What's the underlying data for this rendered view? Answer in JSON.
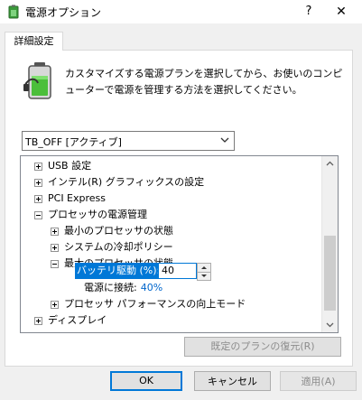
{
  "window": {
    "title": "電源オプション",
    "help": "?",
    "close": "✕"
  },
  "tab": {
    "label": "詳細設定"
  },
  "description": "カスタマイズする電源プランを選択してから、お使いのコンピューターで電源を管理する方法を選択してください。",
  "plan_select": {
    "value": "TB_OFF [アクティブ]"
  },
  "tree": {
    "items": [
      {
        "label": "USB 設定",
        "expander": "plus"
      },
      {
        "label": "インテル(R) グラフィックスの設定",
        "expander": "plus"
      },
      {
        "label": "PCI Express",
        "expander": "plus"
      },
      {
        "label": "プロセッサの電源管理",
        "expander": "minus"
      },
      {
        "label": "最小のプロセッサの状態",
        "expander": "plus"
      },
      {
        "label": "システムの冷却ポリシー",
        "expander": "plus"
      },
      {
        "label": "最大のプロセッサの状態",
        "expander": "minus"
      },
      {
        "label": "プロセッサ パフォーマンスの向上モード",
        "expander": "plus"
      },
      {
        "label": "ディスプレイ",
        "expander": "plus"
      }
    ],
    "battery_label": "バッテリ駆動 (%):",
    "battery_value": "40",
    "plugged_label": "電源に接続:",
    "plugged_value": "40%"
  },
  "restore_button": "既定のプランの復元(R)",
  "buttons": {
    "ok": "OK",
    "cancel": "キャンセル",
    "apply": "適用(A)"
  },
  "colors": {
    "accent": "#0078d7",
    "link_value": "#0066cc"
  },
  "icons": {
    "app": "power-options-icon",
    "battery": "battery-icon"
  }
}
